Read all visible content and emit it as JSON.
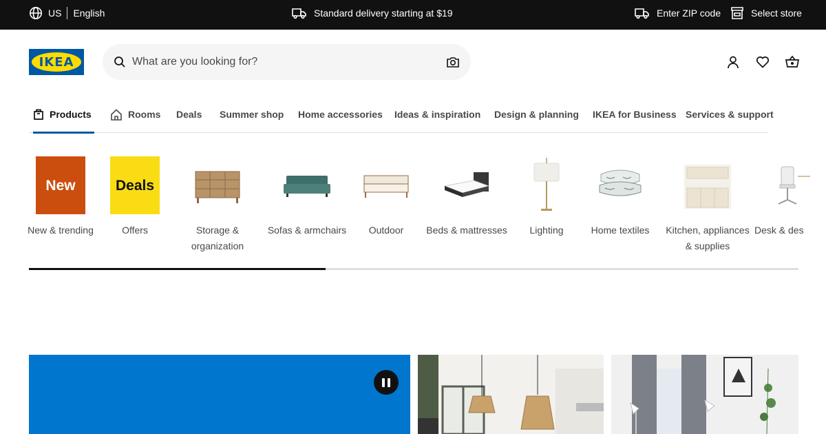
{
  "topbar": {
    "country": "US",
    "language": "English",
    "delivery": "Standard delivery starting at $19",
    "zip": "Enter ZIP code",
    "store": "Select store"
  },
  "header": {
    "logo_text": "IKEA",
    "search_placeholder": "What are you looking for?"
  },
  "nav": {
    "items": [
      {
        "label": "Products",
        "icon": "product-box-icon",
        "active": true
      },
      {
        "label": "Rooms",
        "icon": "house-icon"
      },
      {
        "label": "Deals"
      },
      {
        "label": "Summer shop"
      },
      {
        "label": "Home accessories"
      },
      {
        "label": "Ideas & inspiration"
      },
      {
        "label": "Design & planning"
      },
      {
        "label": "IKEA for Business"
      },
      {
        "label": "Services & support"
      }
    ]
  },
  "categories": [
    {
      "label": "New & trending",
      "tile_text": "New"
    },
    {
      "label": "Offers",
      "tile_text": "Deals"
    },
    {
      "label": "Storage & organization",
      "line1": "Storage &",
      "line2": "organization"
    },
    {
      "label": "Sofas & armchairs"
    },
    {
      "label": "Outdoor"
    },
    {
      "label": "Beds & mattresses"
    },
    {
      "label": "Lighting"
    },
    {
      "label": "Home textiles"
    },
    {
      "label": "Kitchen, appliances & supplies",
      "line1": "Kitchen, appliances",
      "line2": "& supplies"
    },
    {
      "label": "Desk & des"
    }
  ],
  "colors": {
    "brand_blue": "#0058a3",
    "brand_yellow": "#ffdb00",
    "new_tile": "#cc4e0f",
    "deals_tile": "#f9dc14",
    "hero_blue": "#0076cf"
  }
}
